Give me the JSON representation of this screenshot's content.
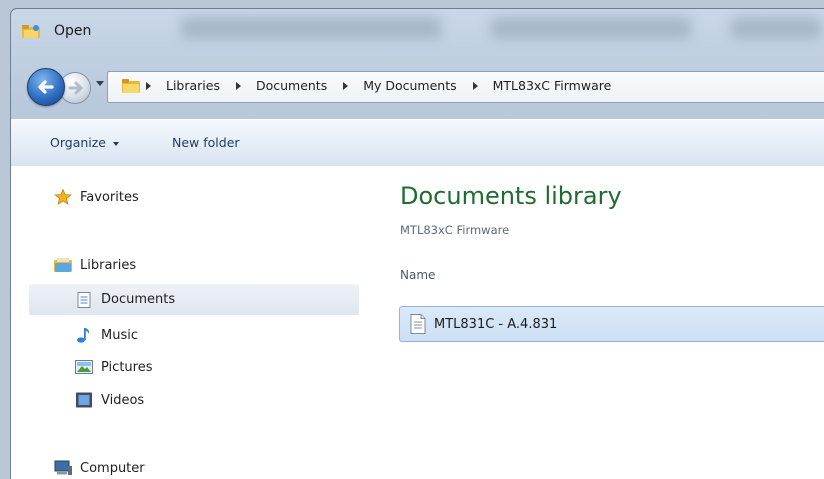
{
  "window": {
    "title": "Open"
  },
  "address": {
    "crumbs": [
      "Libraries",
      "Documents",
      "My Documents",
      "MTL83xC Firmware"
    ]
  },
  "toolbar": {
    "organize_label": "Organize",
    "new_folder_label": "New folder"
  },
  "sidebar": {
    "favorites": "Favorites",
    "libraries": "Libraries",
    "documents": "Documents",
    "music": "Music",
    "pictures": "Pictures",
    "videos": "Videos",
    "computer": "Computer"
  },
  "main": {
    "title": "Documents library",
    "subtitle": "MTL83xC Firmware",
    "column_header": "Name",
    "files": [
      {
        "name": "MTL831C - A.4.831"
      }
    ]
  },
  "icons": {
    "title": "folder-app-icon",
    "back": "back-arrow-icon",
    "forward": "forward-arrow-icon",
    "address": "folder-icon",
    "favorites": "star-icon",
    "libraries": "library-icon",
    "documents": "document-icon",
    "music": "music-note-icon",
    "pictures": "picture-icon",
    "videos": "video-icon",
    "computer": "computer-icon",
    "file": "text-file-icon"
  },
  "colors": {
    "title_green": "#1f6b30",
    "selection_blue": "#cde0f4",
    "toolbar_text": "#1e3a5f"
  }
}
